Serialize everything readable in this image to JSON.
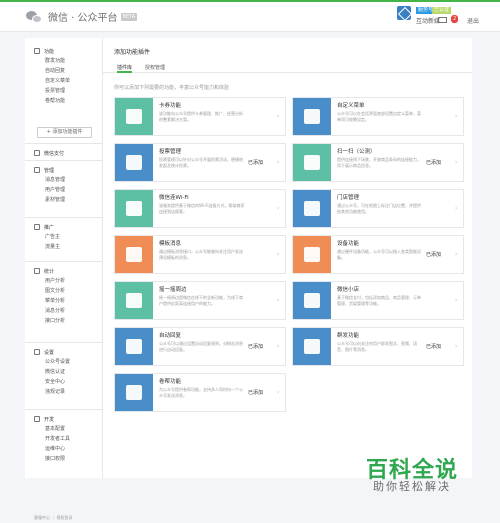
{
  "header": {
    "logo_text": "微信 · 公众平台",
    "logo_badge": "BETA",
    "account_tags": [
      "服务号",
      "已认证"
    ],
    "account_name": "互动新媒",
    "mail_count": "2",
    "logout": "退出"
  },
  "sidebar": {
    "groups": [
      {
        "title": "功能",
        "icon": "grid-icon",
        "items": [
          "群发功能",
          "自动回复",
          "自定义菜单",
          "投票管理",
          "卷帮功能"
        ]
      },
      {
        "title": "微信支付",
        "icon": "wallet-icon",
        "items": []
      },
      {
        "title": "管理",
        "icon": "manage-icon",
        "items": [
          "消息管理",
          "用户管理",
          "素材管理"
        ]
      },
      {
        "title": "推广",
        "icon": "megaphone-icon",
        "items": [
          "广告主",
          "流量主"
        ]
      },
      {
        "title": "统计",
        "icon": "chart-icon",
        "items": [
          "用户分析",
          "图文分析",
          "菜单分析",
          "消息分析",
          "接口分析"
        ]
      },
      {
        "title": "设置",
        "icon": "settings-icon",
        "items": [
          "公众号设置",
          "微信认证",
          "安全中心",
          "违规记录"
        ]
      },
      {
        "title": "开发",
        "icon": "dev-icon",
        "items": [
          "基本配置",
          "开发者工具",
          "运维中心",
          "接口权限"
        ]
      }
    ],
    "add_plugin": "+ 添加功能插件"
  },
  "main": {
    "title": "添加功能插件",
    "tabs": [
      "插件库",
      "授权管理"
    ],
    "hint": "你可以添加下列需要的功能，丰富公众号能力和体验",
    "cards": [
      {
        "name": "卡券功能",
        "desc": "该功能向公众号提供卡券管理、推广、经营分析的整套解决方案。",
        "status": "",
        "color": "#5dbfa3",
        "icon": "card-icon"
      },
      {
        "name": "自定义菜单",
        "desc": "公众号可以在会话界面底部设置自定义菜单，菜单项可按需设定。",
        "status": "",
        "color": "#4a8ec9",
        "icon": "edit-icon"
      },
      {
        "name": "投票管理",
        "desc": "投票管理可以针对公众号开展投票活动，便捷地发起及统计投票。",
        "status": "已添加",
        "color": "#4a8ec9",
        "icon": "bar-chart-icon"
      },
      {
        "name": "扫一扫（公测）",
        "desc": "提供连接线下场景，开放商品条码的连接能力，用于展示商品信息。",
        "status": "已添加",
        "color": "#5dbfa3",
        "icon": "folder-icon"
      },
      {
        "name": "微信连Wi-Fi",
        "desc": "该服务提供基于微信的Wi-Fi连接方式，帮助商家连接到店顾客。",
        "status": "",
        "color": "#5dbfa3",
        "icon": "wifi-icon"
      },
      {
        "name": "门店管理",
        "desc": "通过公众号，可在地图上标注门店位置，并提供给其他功能使用。",
        "status": "",
        "color": "#4a8ec9",
        "icon": "store-icon"
      },
      {
        "name": "模板消息",
        "desc": "通过模板消息接口，公众号能够向关注用户发送预设模板的消息。",
        "status": "",
        "color": "#f08c55",
        "icon": "doc-icon"
      },
      {
        "name": "设备功能",
        "desc": "通过硬件设备功能，公众号可以接入各类智能设备。",
        "status": "已添加",
        "color": "#f08c55",
        "icon": "washer-icon"
      },
      {
        "name": "摇一摇周边",
        "desc": "摇一摇周边是微信在线下的全新功能，为线下商户提供近距离连接用户的能力。",
        "status": "",
        "color": "#5dbfa3",
        "icon": "shake-icon"
      },
      {
        "name": "微信小店",
        "desc": "基于微信支付，包括添加商品、商品管理、订单管理、货架管理等功能。",
        "status": "",
        "color": "#4a8ec9",
        "icon": "shop-icon"
      },
      {
        "name": "自动回复",
        "desc": "公众号可以通过设置自动回复规则，对粉丝消息进行自动回复。",
        "status": "已添加",
        "color": "#4a8ec9",
        "icon": "list-icon"
      },
      {
        "name": "群发功能",
        "desc": "公众号可以向关注的用户群发图文、视频、语音、图片等消息。",
        "status": "已添加",
        "color": "#4a8ec9",
        "icon": "users-icon"
      },
      {
        "name": "卷帮功能",
        "desc": "为公众号提供卷帮功能，支持多人同时向一个公众号发送消息。",
        "status": "已添加",
        "color": "#4a8ec9",
        "icon": "user-icon"
      }
    ]
  },
  "watermark": {
    "title": "百科全说",
    "subtitle": "助你轻松解决"
  },
  "footer": "客服中心 ｜ 侵权投诉"
}
